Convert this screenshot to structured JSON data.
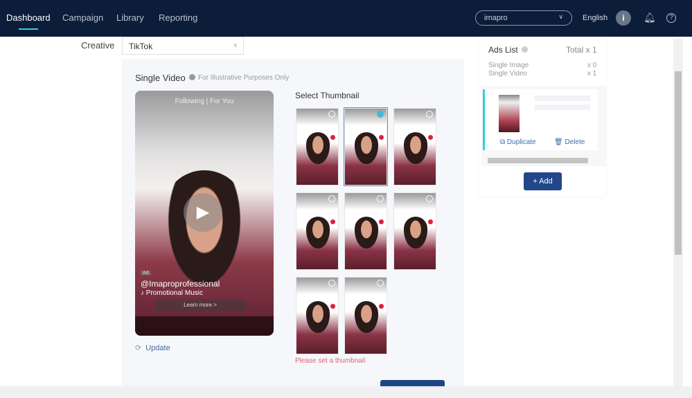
{
  "nav": {
    "items": [
      "Dashboard",
      "Campaign",
      "Library",
      "Reporting"
    ],
    "active": "Dashboard"
  },
  "header": {
    "account": "imapro",
    "language": "English",
    "avatar": "i"
  },
  "form": {
    "creative_label": "Creative",
    "creative_value": "TikTok"
  },
  "panel": {
    "title": "Single Video",
    "note": "For Illustrative Purposes Only",
    "update": "Update",
    "preview": {
      "top": "Following | For You",
      "ad": "Ad",
      "handle": "@Imaproprofessional",
      "music": "♪ Promotional Music",
      "learn_more": "Learn more >"
    },
    "thumbnail_title": "Select Thumbnail",
    "thumbnail_count": 8,
    "selected_thumbnail": 2,
    "error": "Please set a thumbnail"
  },
  "ads_list": {
    "title": "Ads List",
    "total": "Total x 1",
    "single_image": "Single Image",
    "single_image_count": "x 0",
    "single_video": "Single Video",
    "single_video_count": "x 1",
    "duplicate": "Duplicate",
    "delete": "Delete",
    "add": "+ Add"
  },
  "colors": {
    "header": "#0c1d39",
    "accent": "#2ed3d6",
    "primary": "#22468a",
    "error": "#e06070"
  }
}
